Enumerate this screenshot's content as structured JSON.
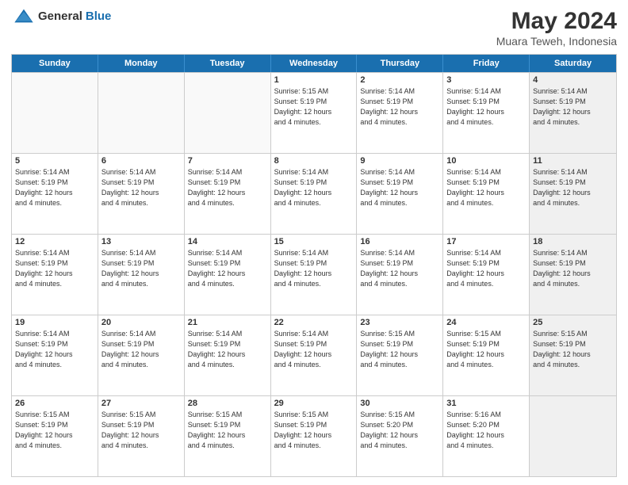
{
  "header": {
    "logo_general": "General",
    "logo_blue": "Blue",
    "title": "May 2024",
    "subtitle": "Muara Teweh, Indonesia"
  },
  "days_of_week": [
    "Sunday",
    "Monday",
    "Tuesday",
    "Wednesday",
    "Thursday",
    "Friday",
    "Saturday"
  ],
  "weeks": [
    [
      {
        "day": "",
        "info": "",
        "empty": true
      },
      {
        "day": "",
        "info": "",
        "empty": true
      },
      {
        "day": "",
        "info": "",
        "empty": true
      },
      {
        "day": "1",
        "info": "Sunrise: 5:15 AM\nSunset: 5:19 PM\nDaylight: 12 hours\nand 4 minutes.",
        "empty": false
      },
      {
        "day": "2",
        "info": "Sunrise: 5:14 AM\nSunset: 5:19 PM\nDaylight: 12 hours\nand 4 minutes.",
        "empty": false
      },
      {
        "day": "3",
        "info": "Sunrise: 5:14 AM\nSunset: 5:19 PM\nDaylight: 12 hours\nand 4 minutes.",
        "empty": false
      },
      {
        "day": "4",
        "info": "Sunrise: 5:14 AM\nSunset: 5:19 PM\nDaylight: 12 hours\nand 4 minutes.",
        "empty": false,
        "shaded": true
      }
    ],
    [
      {
        "day": "5",
        "info": "Sunrise: 5:14 AM\nSunset: 5:19 PM\nDaylight: 12 hours\nand 4 minutes.",
        "empty": false
      },
      {
        "day": "6",
        "info": "Sunrise: 5:14 AM\nSunset: 5:19 PM\nDaylight: 12 hours\nand 4 minutes.",
        "empty": false
      },
      {
        "day": "7",
        "info": "Sunrise: 5:14 AM\nSunset: 5:19 PM\nDaylight: 12 hours\nand 4 minutes.",
        "empty": false
      },
      {
        "day": "8",
        "info": "Sunrise: 5:14 AM\nSunset: 5:19 PM\nDaylight: 12 hours\nand 4 minutes.",
        "empty": false
      },
      {
        "day": "9",
        "info": "Sunrise: 5:14 AM\nSunset: 5:19 PM\nDaylight: 12 hours\nand 4 minutes.",
        "empty": false
      },
      {
        "day": "10",
        "info": "Sunrise: 5:14 AM\nSunset: 5:19 PM\nDaylight: 12 hours\nand 4 minutes.",
        "empty": false
      },
      {
        "day": "11",
        "info": "Sunrise: 5:14 AM\nSunset: 5:19 PM\nDaylight: 12 hours\nand 4 minutes.",
        "empty": false,
        "shaded": true
      }
    ],
    [
      {
        "day": "12",
        "info": "Sunrise: 5:14 AM\nSunset: 5:19 PM\nDaylight: 12 hours\nand 4 minutes.",
        "empty": false
      },
      {
        "day": "13",
        "info": "Sunrise: 5:14 AM\nSunset: 5:19 PM\nDaylight: 12 hours\nand 4 minutes.",
        "empty": false
      },
      {
        "day": "14",
        "info": "Sunrise: 5:14 AM\nSunset: 5:19 PM\nDaylight: 12 hours\nand 4 minutes.",
        "empty": false
      },
      {
        "day": "15",
        "info": "Sunrise: 5:14 AM\nSunset: 5:19 PM\nDaylight: 12 hours\nand 4 minutes.",
        "empty": false
      },
      {
        "day": "16",
        "info": "Sunrise: 5:14 AM\nSunset: 5:19 PM\nDaylight: 12 hours\nand 4 minutes.",
        "empty": false
      },
      {
        "day": "17",
        "info": "Sunrise: 5:14 AM\nSunset: 5:19 PM\nDaylight: 12 hours\nand 4 minutes.",
        "empty": false
      },
      {
        "day": "18",
        "info": "Sunrise: 5:14 AM\nSunset: 5:19 PM\nDaylight: 12 hours\nand 4 minutes.",
        "empty": false,
        "shaded": true
      }
    ],
    [
      {
        "day": "19",
        "info": "Sunrise: 5:14 AM\nSunset: 5:19 PM\nDaylight: 12 hours\nand 4 minutes.",
        "empty": false
      },
      {
        "day": "20",
        "info": "Sunrise: 5:14 AM\nSunset: 5:19 PM\nDaylight: 12 hours\nand 4 minutes.",
        "empty": false
      },
      {
        "day": "21",
        "info": "Sunrise: 5:14 AM\nSunset: 5:19 PM\nDaylight: 12 hours\nand 4 minutes.",
        "empty": false
      },
      {
        "day": "22",
        "info": "Sunrise: 5:14 AM\nSunset: 5:19 PM\nDaylight: 12 hours\nand 4 minutes.",
        "empty": false
      },
      {
        "day": "23",
        "info": "Sunrise: 5:15 AM\nSunset: 5:19 PM\nDaylight: 12 hours\nand 4 minutes.",
        "empty": false
      },
      {
        "day": "24",
        "info": "Sunrise: 5:15 AM\nSunset: 5:19 PM\nDaylight: 12 hours\nand 4 minutes.",
        "empty": false
      },
      {
        "day": "25",
        "info": "Sunrise: 5:15 AM\nSunset: 5:19 PM\nDaylight: 12 hours\nand 4 minutes.",
        "empty": false,
        "shaded": true
      }
    ],
    [
      {
        "day": "26",
        "info": "Sunrise: 5:15 AM\nSunset: 5:19 PM\nDaylight: 12 hours\nand 4 minutes.",
        "empty": false
      },
      {
        "day": "27",
        "info": "Sunrise: 5:15 AM\nSunset: 5:19 PM\nDaylight: 12 hours\nand 4 minutes.",
        "empty": false
      },
      {
        "day": "28",
        "info": "Sunrise: 5:15 AM\nSunset: 5:19 PM\nDaylight: 12 hours\nand 4 minutes.",
        "empty": false
      },
      {
        "day": "29",
        "info": "Sunrise: 5:15 AM\nSunset: 5:19 PM\nDaylight: 12 hours\nand 4 minutes.",
        "empty": false
      },
      {
        "day": "30",
        "info": "Sunrise: 5:15 AM\nSunset: 5:20 PM\nDaylight: 12 hours\nand 4 minutes.",
        "empty": false
      },
      {
        "day": "31",
        "info": "Sunrise: 5:16 AM\nSunset: 5:20 PM\nDaylight: 12 hours\nand 4 minutes.",
        "empty": false
      },
      {
        "day": "",
        "info": "",
        "empty": true,
        "shaded": true
      }
    ]
  ]
}
